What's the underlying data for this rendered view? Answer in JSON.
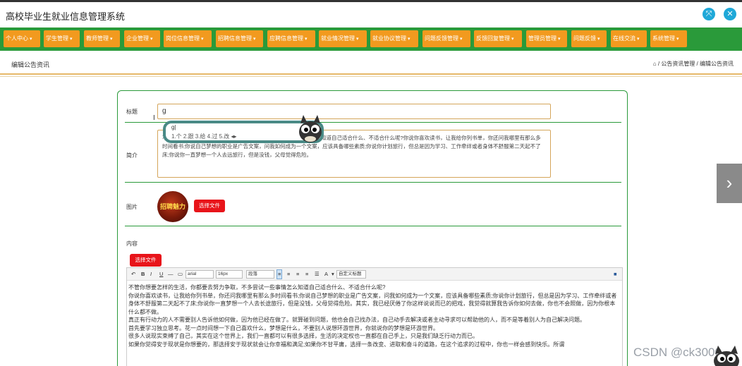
{
  "app": {
    "title": "高校毕业生就业信息管理系统"
  },
  "nav": {
    "items": [
      "个人中心",
      "学生管理",
      "教师管理",
      "企业管理",
      "岗位信息管理",
      "招聘信息管理",
      "应聘信息管理",
      "就业情况管理",
      "就业协议管理",
      "问题反馈管理",
      "反馈回复管理",
      "管理员管理",
      "问题反馈",
      "在线交流",
      "系统管理"
    ]
  },
  "page": {
    "title": "编辑公告资讯",
    "breadcrumb": "/ 公告资讯管理 / 编辑公告资讯"
  },
  "form": {
    "title_label": "标题",
    "title_value": "g",
    "intro_label": "简介",
    "intro_text": "不管你想要怎样的生活，你都要去努力争取，不多尝试一些事情怎么知道自己适合什么、不适合什么呢?你说你喜欢读书，让我给你列书单，你还问我哪里有那么多时间看书;你说自己梦想的职业是广告文案，问我如何成为一个文案，应该具备哪些素质;你说你计划旅行，但总是因为学习、工作牵绊或者身体不舒服第二天起不了床;你说你一直梦想一个人去远旅行，但是没钱，父母觉得危险。",
    "image_label": "图片",
    "avatar_text": "招聘魅力",
    "choose_file": "选择文件",
    "content_label": "内容"
  },
  "ime": {
    "composition": "g|",
    "candidates": "1.个  2.跟  3.给  4.过  5.改"
  },
  "editor": {
    "font": "arial",
    "size": "16px",
    "format": "段落",
    "custom_title": "自定义标题",
    "paragraphs": [
      "不管你想要怎样的生活，你都要去努力争取，不多尝试一些事情怎么知道自己适合什么、不适合什么呢?",
      "你说你喜欢读书，让我给你列书单，你还问我哪里有那么多时间看书;你说自己梦想的职业是广告文案，问我如何成为一个文案，应该具备哪些素质;你说你计划旅行，但总是因为学习、工作牵绊或者身体不舒服第二天起不了床;你说你一直梦想一个人去长途旅行，但是没钱，父母觉得危险。其实，我已经厌倦了你这样说说而已的把戏，我觉得就算我告诉你如何去做，你也不会照做，因为你根本什么都不做。",
      "真正有行动力的人不需要别人告诉他如何做，因为他已经在做了。就算碰到问题，他也会自己找办法，自己动手去解决或者主动寻求可以帮助他的人，而不是等着别人为自己解决问题。",
      "首先要学习独立思考。花一点时间想一下自己喜欢什么，梦想是什么，不要别人说想环游世界，你就说你的梦想是环游世界。",
      "很多人说现实束缚了自己，其实在这个世界上，我们一直都可以有很多选择，生活的决定权也一直都在自己手上，只是我们缺乏行动力而已。",
      "如果你觉得安于现状是你想要的，那选择安于现状就会让你幸福和满足;如果你不甘平庸，选择一条改变、进取和奋斗的道路，在这个追求的过程中，你也一样会感到快乐。所谓"
    ]
  },
  "watermark": "CSDN @ck3000"
}
